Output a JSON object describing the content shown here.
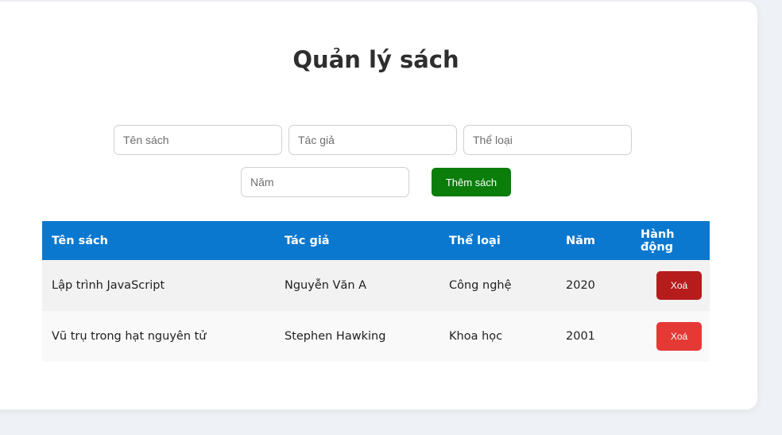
{
  "page": {
    "title": "Quản lý sách"
  },
  "form": {
    "title_placeholder": "Tên sách",
    "author_placeholder": "Tác giả",
    "genre_placeholder": "Thể loại",
    "year_placeholder": "Năm",
    "add_button_label": "Thêm sách"
  },
  "table": {
    "headers": [
      "Tên sách",
      "Tác giả",
      "Thể loại",
      "Năm",
      "Hành động"
    ],
    "rows": [
      {
        "title": "Lập trình JavaScript",
        "author": "Nguyễn Văn A",
        "genre": "Công nghệ",
        "year": "2020",
        "action_label": "Xoá",
        "action_color": "#b71c1c"
      },
      {
        "title": "Vũ trụ trong hạt nguyên tử",
        "author": "Stephen Hawking",
        "genre": "Khoa học",
        "year": "2001",
        "action_label": "Xoá",
        "action_color": "#e53935"
      }
    ]
  },
  "colors": {
    "header_bg": "#0a78cf",
    "add_button_bg": "#0a7d0a"
  }
}
